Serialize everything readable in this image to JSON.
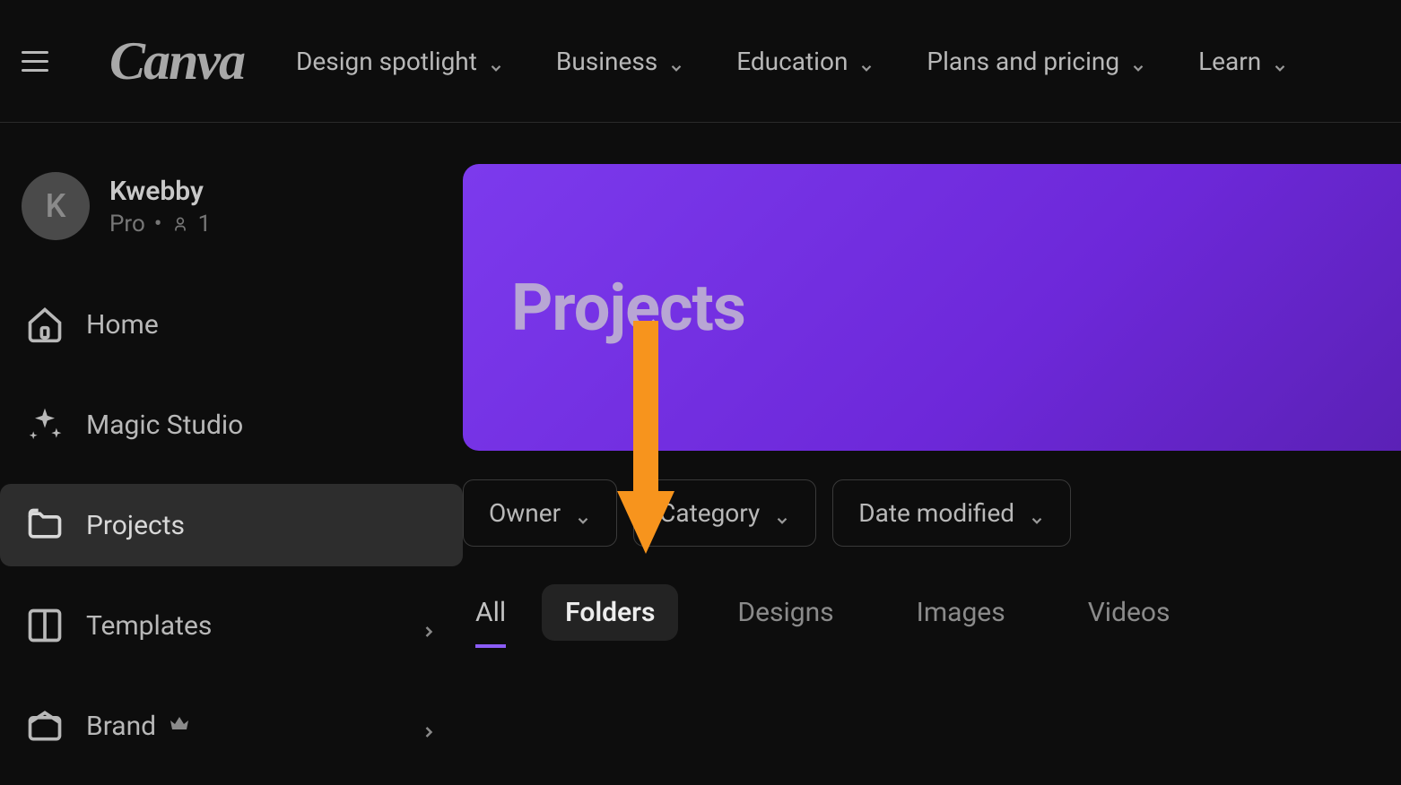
{
  "brand": "Canva",
  "topnav": {
    "items": [
      {
        "label": "Design spotlight"
      },
      {
        "label": "Business"
      },
      {
        "label": "Education"
      },
      {
        "label": "Plans and pricing"
      },
      {
        "label": "Learn"
      }
    ]
  },
  "user": {
    "initial": "K",
    "name": "Kwebby",
    "plan": "Pro",
    "members": "1"
  },
  "sidebar": {
    "items": [
      {
        "label": "Home"
      },
      {
        "label": "Magic Studio"
      },
      {
        "label": "Projects"
      },
      {
        "label": "Templates"
      },
      {
        "label": "Brand"
      }
    ]
  },
  "page": {
    "title": "Projects"
  },
  "filters": [
    {
      "label": "Owner"
    },
    {
      "label": "Category"
    },
    {
      "label": "Date modified"
    }
  ],
  "tabs": [
    {
      "label": "All"
    },
    {
      "label": "Folders"
    },
    {
      "label": "Designs"
    },
    {
      "label": "Images"
    },
    {
      "label": "Videos"
    }
  ],
  "annotation": {
    "color": "#f7941d"
  }
}
